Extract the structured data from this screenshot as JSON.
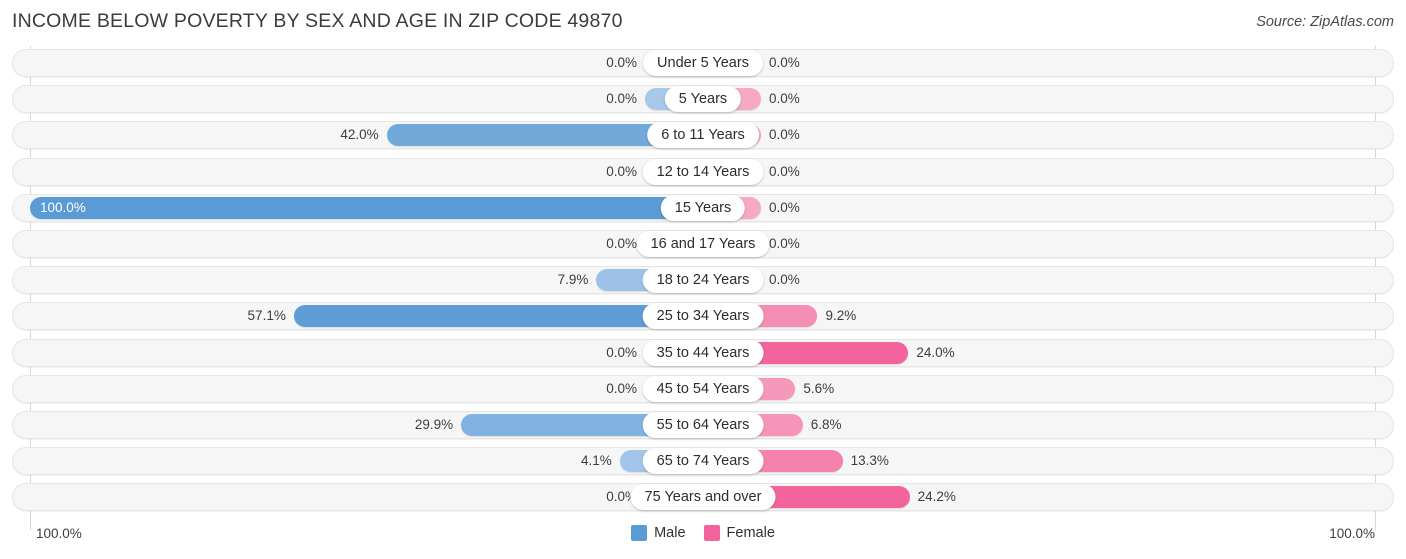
{
  "header": {
    "title": "INCOME BELOW POVERTY BY SEX AND AGE IN ZIP CODE 49870",
    "source": "Source: ZipAtlas.com"
  },
  "footer": {
    "axis_left": "100.0%",
    "axis_right": "100.0%",
    "legend": [
      {
        "label": "Male",
        "color": "#5b9bd5"
      },
      {
        "label": "Female",
        "color": "#f2649b"
      }
    ]
  },
  "colors": {
    "male_light": "#a8c8ea",
    "male_strong": "#5b9bd5",
    "female_light": "#f7a8c4",
    "female_strong": "#f2649b",
    "track": "#f6f6f6",
    "track_border": "#e6e6e6",
    "axis": "#d8d8d8"
  },
  "chart_data": {
    "type": "bar",
    "subtype": "diverging-bar",
    "title": "INCOME BELOW POVERTY BY SEX AND AGE IN ZIP CODE 49870",
    "xlabel": "",
    "ylabel": "",
    "xlim": [
      100.0,
      100.0
    ],
    "grid": false,
    "legend_position": "bottom-center",
    "categories": [
      "Under 5 Years",
      "5 Years",
      "6 to 11 Years",
      "12 to 14 Years",
      "15 Years",
      "16 and 17 Years",
      "18 to 24 Years",
      "25 to 34 Years",
      "35 to 44 Years",
      "45 to 54 Years",
      "55 to 64 Years",
      "65 to 74 Years",
      "75 Years and over"
    ],
    "series": [
      {
        "name": "Male",
        "values": [
          0.0,
          0.0,
          42.0,
          0.0,
          100.0,
          0.0,
          7.9,
          57.1,
          0.0,
          0.0,
          29.9,
          4.1,
          0.0
        ],
        "labels": [
          "0.0%",
          "0.0%",
          "42.0%",
          "0.0%",
          "100.0%",
          "0.0%",
          "7.9%",
          "57.1%",
          "0.0%",
          "0.0%",
          "29.9%",
          "4.1%",
          "0.0%"
        ]
      },
      {
        "name": "Female",
        "values": [
          0.0,
          0.0,
          0.0,
          0.0,
          0.0,
          0.0,
          0.0,
          9.2,
          24.0,
          5.6,
          6.8,
          13.3,
          24.2
        ],
        "labels": [
          "0.0%",
          "0.0%",
          "0.0%",
          "0.0%",
          "0.0%",
          "0.0%",
          "0.0%",
          "9.2%",
          "24.0%",
          "5.6%",
          "6.8%",
          "13.3%",
          "24.2%"
        ]
      }
    ]
  }
}
